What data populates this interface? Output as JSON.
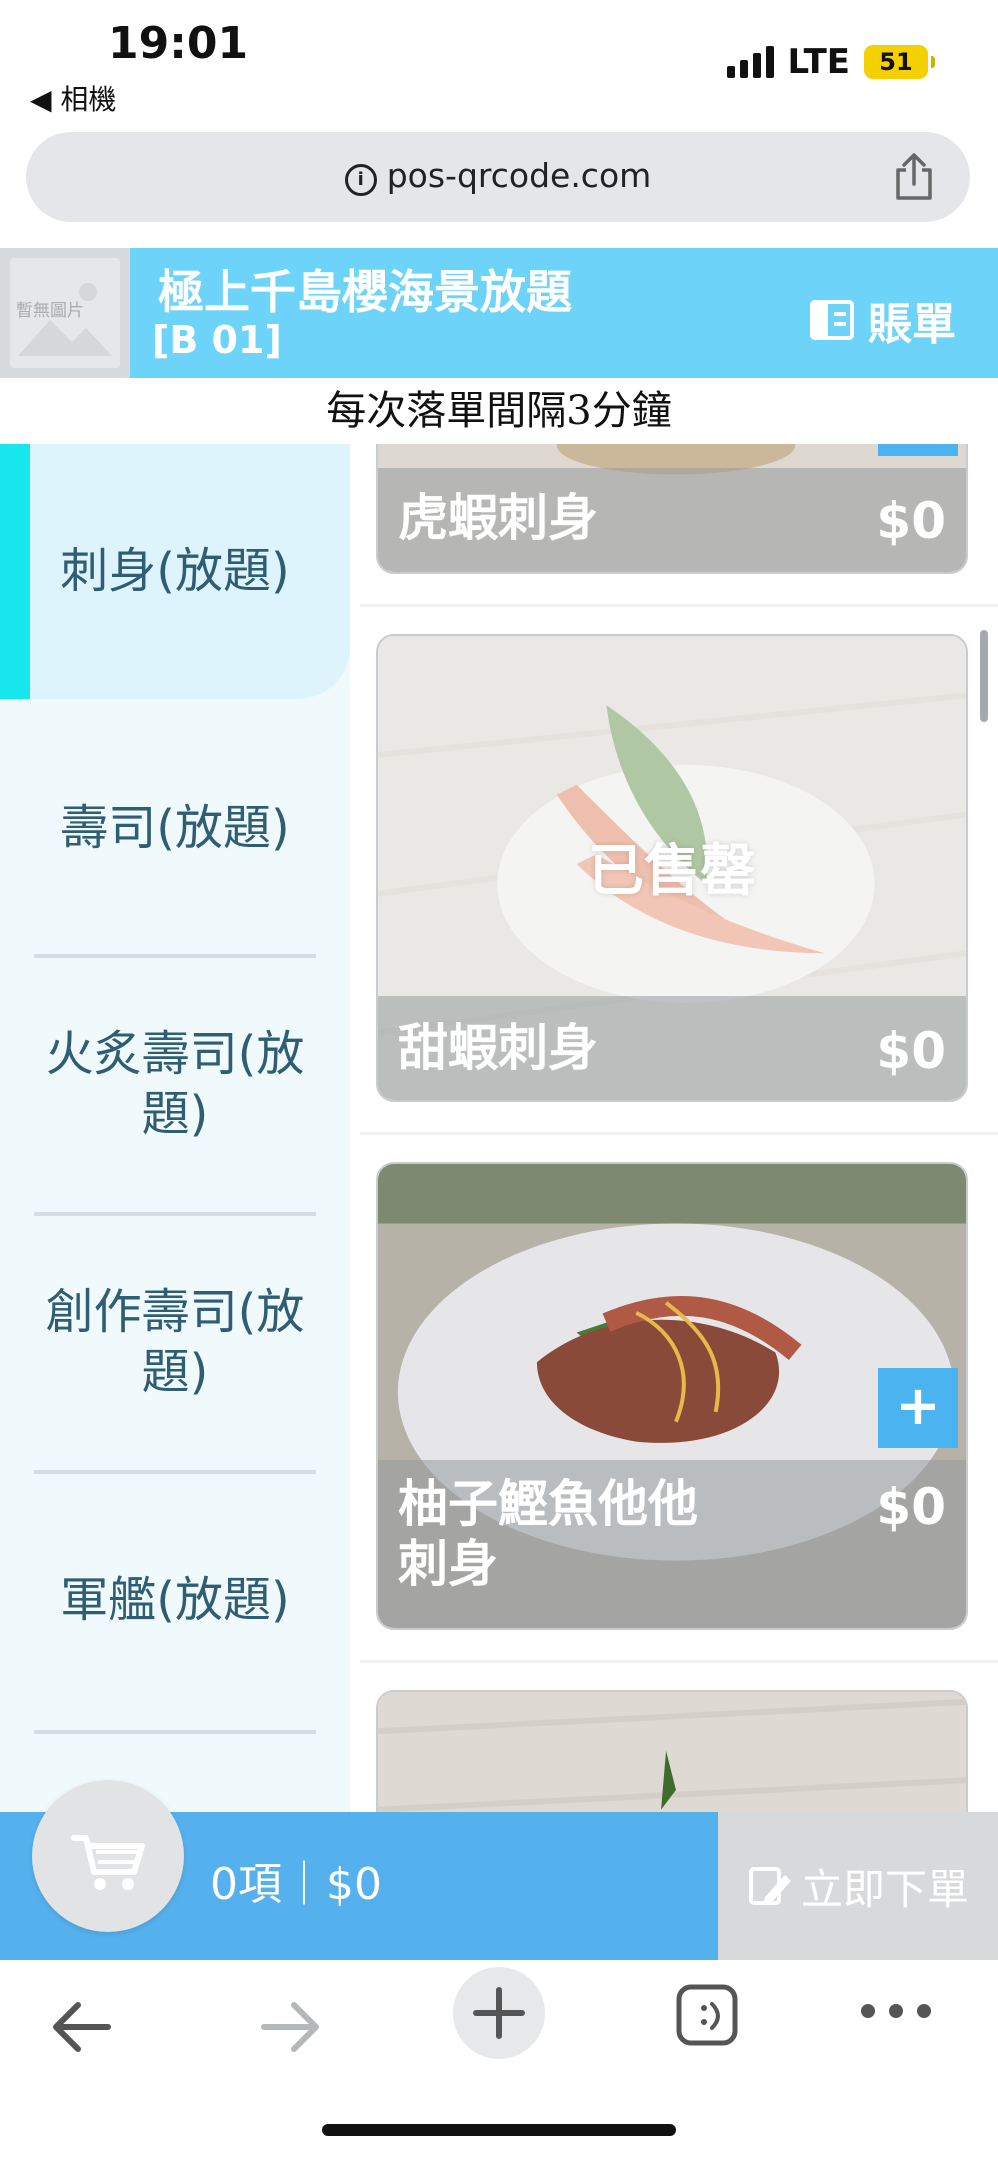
{
  "status_bar": {
    "time": "19:01",
    "back_app": "◀ 相機",
    "network": "LTE",
    "battery": "51"
  },
  "browser": {
    "url": "pos-qrcode.com"
  },
  "header": {
    "logo_placeholder": "暫無圖片",
    "shop_name": "極上千島櫻海景放題",
    "table_no": "[B 01]",
    "bill_label": "賬單",
    "notice": "每次落單間隔3分鐘"
  },
  "categories": [
    {
      "label": "刺身(放題)",
      "active": true
    },
    {
      "label": "壽司(放題)",
      "active": false
    },
    {
      "label": "火炙壽司(放\n題)",
      "active": false
    },
    {
      "label": "創作壽司(放\n題)",
      "active": false
    },
    {
      "label": "軍艦(放題)",
      "active": false
    }
  ],
  "menu_items": [
    {
      "name": "虎蝦刺身",
      "price": "$0"
    },
    {
      "name": "甜蝦刺身",
      "price": "$0",
      "status": "已售罄"
    },
    {
      "name": "柚子鰹魚他他\n刺身",
      "price": "$0"
    }
  ],
  "cart": {
    "summary": "0項｜$0",
    "order_label": "立即下單"
  },
  "colors": {
    "header_bg": "#6dd3f8",
    "accent_cyan": "#17e6ee",
    "cart_bar": "#55b1ed",
    "add_button": "#4ab3f0",
    "category_text": "#2f5d73"
  }
}
